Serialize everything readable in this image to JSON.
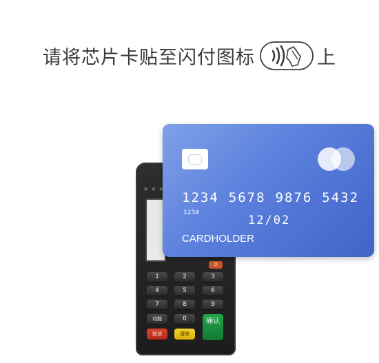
{
  "instruction": {
    "before_icon": "请将芯片卡贴至闪付图标",
    "after_icon": "上",
    "icon": "contactless-tap-icon"
  },
  "card": {
    "number_groups": [
      "1234",
      "5678",
      "9876",
      "5432"
    ],
    "small_number": "1234",
    "expiry": "12/02",
    "holder": "CARDHOLDER",
    "chip_icon": "chip-icon",
    "brand_icon": "card-brand-circles-icon",
    "colors": {
      "top": "#7fa0e8",
      "bottom": "#3f64c8"
    }
  },
  "terminal": {
    "keys": [
      "1",
      "2",
      "3",
      "4",
      "5",
      "6",
      "7",
      "8",
      "9",
      "功能",
      "0",
      "取消",
      "清除",
      "确认"
    ],
    "power_icon": "power-icon"
  }
}
